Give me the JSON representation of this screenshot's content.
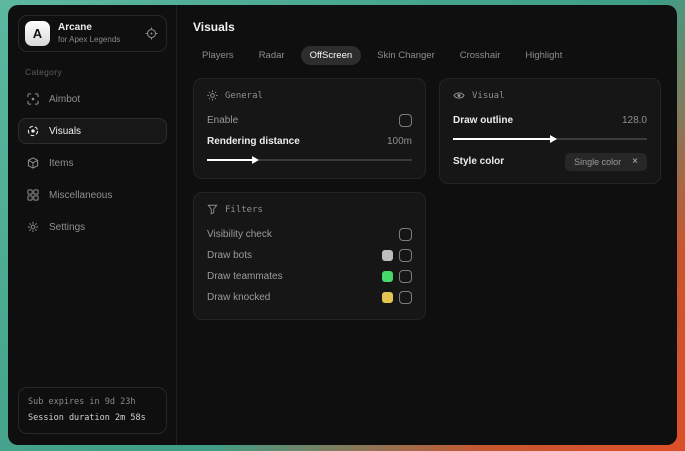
{
  "colors": {
    "desktop_teal": "#46a38c",
    "desktop_orange": "#dd4f28",
    "swatch_gray": "#bdbdbd",
    "swatch_green": "#46d969",
    "swatch_yellow": "#e2c452"
  },
  "sidebar": {
    "app": {
      "logo_letter": "A",
      "name": "Arcane",
      "subtitle": "for Apex Legends",
      "header_icon": "scope-icon"
    },
    "category_label": "Category",
    "items": [
      {
        "label": "Aimbot",
        "icon": "crosshair-scan-icon"
      },
      {
        "label": "Visuals",
        "icon": "eye-scan-icon"
      },
      {
        "label": "Items",
        "icon": "cube-icon"
      },
      {
        "label": "Miscellaneous",
        "icon": "grid-icon"
      },
      {
        "label": "Settings",
        "icon": "gear-icon"
      }
    ],
    "status": {
      "line1": "Sub expires in 9d 23h",
      "line2": "Session duration 2m 58s"
    }
  },
  "main": {
    "title": "Visuals",
    "tabs": [
      {
        "label": "Players"
      },
      {
        "label": "Radar"
      },
      {
        "label": "OffScreen"
      },
      {
        "label": "Skin Changer"
      },
      {
        "label": "Crosshair"
      },
      {
        "label": "Highlight"
      }
    ],
    "cards": {
      "general": {
        "title": "General",
        "icon": "sun-icon",
        "enable_label": "Enable",
        "enable_checked": false,
        "slider": {
          "label": "Rendering distance",
          "value": "100m",
          "fill": "22%"
        }
      },
      "visual": {
        "title": "Visual",
        "icon": "eye-icon",
        "slider": {
          "label": "Draw outline",
          "value": "128.0",
          "fill": "50%"
        },
        "select": {
          "label": "Style color",
          "value": "Single color",
          "clear_label": "×"
        }
      },
      "filters": {
        "title": "Filters",
        "icon": "funnel-icon",
        "rows": [
          {
            "label": "Visibility check",
            "swatch": null,
            "checked": false
          },
          {
            "label": "Draw bots",
            "swatch": "#bdbdbd",
            "checked": false
          },
          {
            "label": "Draw teammates",
            "swatch": "#46d969",
            "checked": false
          },
          {
            "label": "Draw knocked",
            "swatch": "#e2c452",
            "checked": false
          }
        ]
      }
    }
  }
}
